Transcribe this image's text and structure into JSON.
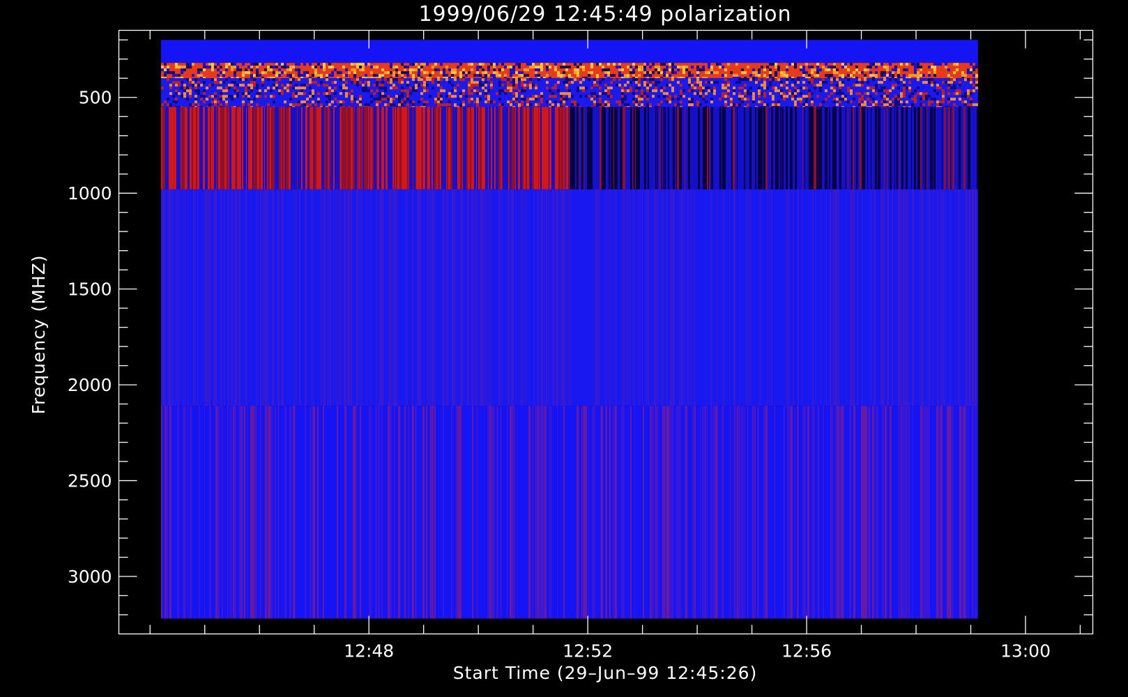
{
  "chart_data": {
    "type": "heatmap",
    "title": "1999/06/29 12:45:49 polarization",
    "xlabel": "Start Time (29–Jun–99 12:45:26)",
    "ylabel": "Frequency (MHZ)",
    "x_ticks": [
      {
        "value": 28.57,
        "label": "12:48"
      },
      {
        "value": 32.57,
        "label": "12:52"
      },
      {
        "value": 36.57,
        "label": "12:56"
      },
      {
        "value": 40.57,
        "label": "13:00"
      }
    ],
    "y_ticks": [
      {
        "value": 500,
        "label": "500"
      },
      {
        "value": 1000,
        "label": "1000"
      },
      {
        "value": 1500,
        "label": "1500"
      },
      {
        "value": 2000,
        "label": "2000"
      },
      {
        "value": 2500,
        "label": "2500"
      },
      {
        "value": 3000,
        "label": "3000"
      }
    ],
    "xlim": [
      24.0,
      41.8
    ],
    "ylim": [
      3300,
      150
    ],
    "data_extent": {
      "x": [
        24.77,
        39.7
      ],
      "y": [
        200,
        3220
      ]
    },
    "bands": [
      {
        "range": [
          200,
          320
        ],
        "pattern": "uniform",
        "colors": [
          "#1414f5"
        ]
      },
      {
        "range": [
          320,
          400
        ],
        "pattern": "speckle",
        "colors": [
          "#e83a1a",
          "#f5a020",
          "#1010e0",
          "#0a0a60",
          "#ffcc40"
        ]
      },
      {
        "range": [
          400,
          550
        ],
        "pattern": "speckle",
        "colors": [
          "#1a1af0",
          "#c02020",
          "#ff8c30",
          "#0a0a80"
        ]
      },
      {
        "range": [
          550,
          980
        ],
        "pattern": "stripes",
        "colors": [
          "#d01818",
          "#8a1030",
          "#1010d0",
          "#000040"
        ]
      },
      {
        "range": [
          980,
          2110
        ],
        "pattern": "stripes",
        "colors": [
          "#1818f0",
          "#2a1ae0",
          "#3a1ad0"
        ]
      },
      {
        "range": [
          2110,
          3220
        ],
        "pattern": "stripes",
        "colors": [
          "#1414f5",
          "#3a18d8",
          "#6a1aa0"
        ]
      }
    ],
    "colors": {
      "background": "#000000",
      "axes": "#ffffff"
    }
  }
}
